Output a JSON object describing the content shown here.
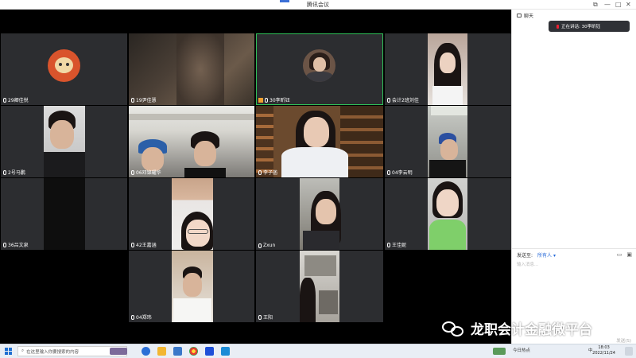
{
  "window": {
    "title": "腾讯会议",
    "controls": [
      "⧉",
      "—",
      "□",
      "✕"
    ]
  },
  "participants": [
    {
      "name": "29卿佳悦",
      "label_key": "p0"
    },
    {
      "name": "19尹佳慧",
      "label_key": "p1"
    },
    {
      "name": "30李昕钰",
      "label_key": "p2",
      "active": true
    },
    {
      "name": "会计2班刘佳",
      "label_key": "p3"
    },
    {
      "name": "2号马鹏",
      "label_key": "p4"
    },
    {
      "name": "06邓锦耀华",
      "label_key": "p5"
    },
    {
      "name": "李子菡",
      "label_key": "p6"
    },
    {
      "name": "04李云明",
      "label_key": "p7"
    },
    {
      "name": "36吕文泉",
      "label_key": "p8"
    },
    {
      "name": "42王嘉涵",
      "label_key": "p9"
    },
    {
      "name": "Zxun",
      "label_key": "p10"
    },
    {
      "name": "王佳妮",
      "label_key": "p11"
    },
    {
      "name": "04郑玮",
      "label_key": "p12"
    },
    {
      "name": "王阳",
      "label_key": "p13"
    }
  ],
  "chat": {
    "header": "聊天",
    "speaking": "正在讲话: 30李昕钰",
    "send_to_label": "发送至:",
    "send_to_value": "所有人 ▾",
    "input_placeholder": "输入消息...",
    "send_button": "发送(S)"
  },
  "watermark": {
    "text": "龙职会计金融微平台"
  },
  "taskbar": {
    "search_placeholder": "在这里输入你要搜索的内容",
    "tray_news": "今日热点",
    "ime": "中",
    "time": "18:03",
    "date": "2022/11/24"
  },
  "colors": {
    "active_border": "#2fbf58",
    "tile_bg": "#2c2d30",
    "accent": "#2468d8"
  }
}
